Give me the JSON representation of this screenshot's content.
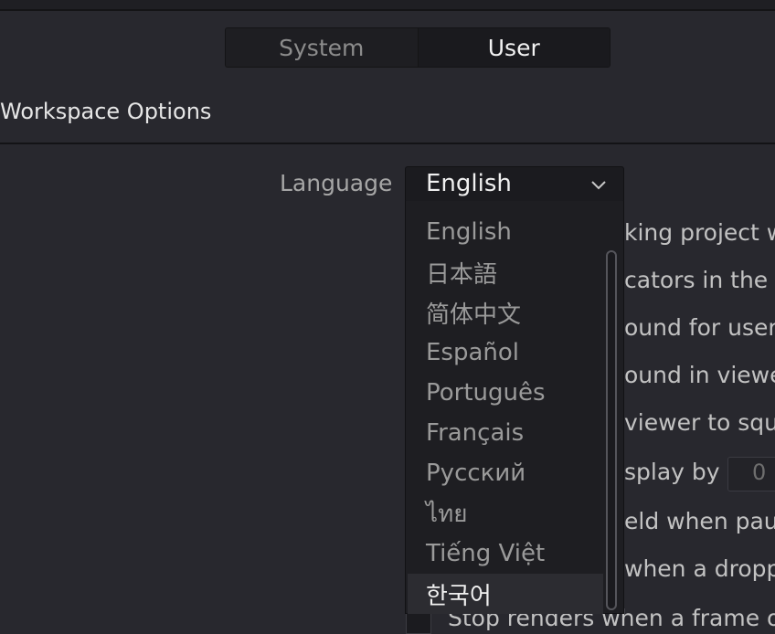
{
  "tabs": [
    {
      "label": "System",
      "active": false
    },
    {
      "label": "User",
      "active": true
    }
  ],
  "section": {
    "title": "Workspace Options"
  },
  "language": {
    "label": "Language",
    "selected": "English",
    "options": [
      "English",
      "日本語",
      "简体中文",
      "Español",
      "Português",
      "Français",
      "Русский",
      "ไทย",
      "Tiếng Việt",
      "한국어"
    ],
    "highlighted_index": 9
  },
  "background_rows": [
    "king project w",
    "cators in the u",
    "ound for user",
    "ound in viewe",
    "viewer to squa",
    "splay by",
    "eld when paus",
    "when a droppe"
  ],
  "number_field": {
    "value": "0"
  },
  "bottom_row": "Stop renders when a frame or"
}
